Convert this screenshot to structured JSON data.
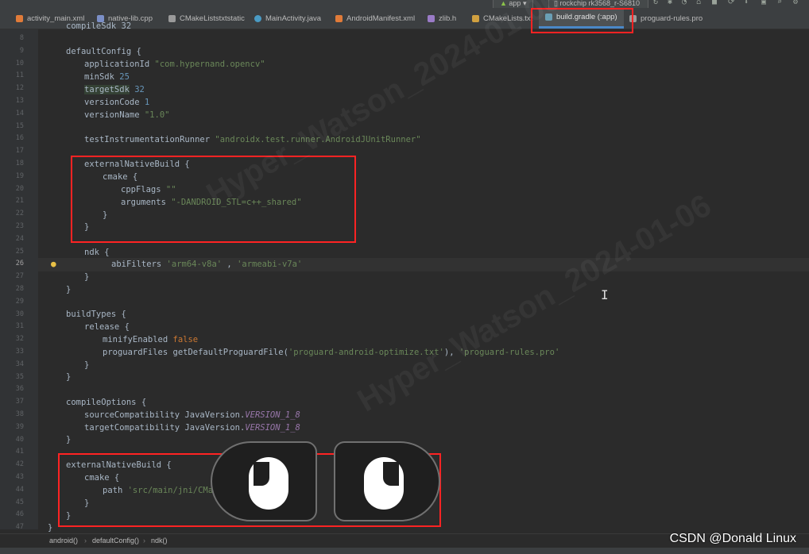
{
  "toolbar": {
    "run_config": "app",
    "device": "rockchip rk3568_r-S6810"
  },
  "tabs": [
    {
      "label": "activity_main.xml",
      "icon": "xml-file-icon",
      "color": "#e07b39"
    },
    {
      "label": "native-lib.cpp",
      "icon": "cpp-file-icon",
      "color": "#7b8fc7"
    },
    {
      "label": "CMakeListstxtstatic",
      "icon": "text-file-icon",
      "color": "#9a9a9a"
    },
    {
      "label": "MainActivity.java",
      "icon": "java-class-icon",
      "color": "#4a9bc4"
    },
    {
      "label": "AndroidManifest.xml",
      "icon": "xml-file-icon",
      "color": "#e07b39"
    },
    {
      "label": "zlib.h",
      "icon": "header-file-icon",
      "color": "#9a7bc7"
    },
    {
      "label": "CMakeLists.txt",
      "icon": "cmake-file-icon",
      "color": "#d0a040"
    },
    {
      "label": "build.gradle (:app)",
      "icon": "gradle-file-icon",
      "color": "#6a9fb5",
      "active": true
    },
    {
      "label": "proguard-rules.pro",
      "icon": "text-file-icon",
      "color": "#9a9a9a"
    }
  ],
  "line_numbers": [
    "8",
    "9",
    "10",
    "11",
    "12",
    "13",
    "14",
    "15",
    "16",
    "17",
    "18",
    "19",
    "20",
    "21",
    "22",
    "23",
    "24",
    "25",
    "26",
    "27",
    "28",
    "29",
    "30",
    "31",
    "32",
    "33",
    "34",
    "35",
    "36",
    "37",
    "38",
    "39",
    "40",
    "41",
    "42",
    "43",
    "44",
    "45",
    "46",
    "47"
  ],
  "code": {
    "l1": "compileSdk 32",
    "l3": "defaultConfig {",
    "l4_kw": "applicationId ",
    "l4_str": "\"com.hypernand.opencv\"",
    "l5_kw": "minSdk ",
    "l5_num": "25",
    "l6_kw": "targetSdk",
    "l6_num": " 32",
    "l7_kw": "versionCode ",
    "l7_num": "1",
    "l8_kw": "versionName ",
    "l8_str": "\"1.0\"",
    "l10_kw": "testInstrumentationRunner ",
    "l10_str": "\"androidx.test.runner.AndroidJUnitRunner\"",
    "l12": "externalNativeBuild {",
    "l13": "cmake {",
    "l14_kw": "cppFlags ",
    "l14_str": "\"\"",
    "l15_kw": "arguments ",
    "l15_str": "\"-DANDROID_STL=c++_shared\"",
    "l16": "}",
    "l17": "}",
    "l19": "ndk {",
    "l20_kw": "abiFilters ",
    "l20_str1": "'arm64-v8a'",
    "l20_sep": " , ",
    "l20_str2": "'armeabi-v7a'",
    "l21": "}",
    "l22": "}",
    "l24": "buildTypes {",
    "l25": "release {",
    "l26_kw": "minifyEnabled ",
    "l26_bool": "false",
    "l27_a": "proguardFiles getDefaultProguardFile(",
    "l27_s1": "'proguard-android-optimize.txt'",
    "l27_b": "), ",
    "l27_s2": "'proguard-rules.pro'",
    "l28": "}",
    "l29": "}",
    "l31": "compileOptions {",
    "l32_a": "sourceCompatibility JavaVersion.",
    "l32_b": "VERSION_1_8",
    "l33_a": "targetCompatibility JavaVersion.",
    "l33_b": "VERSION_1_8",
    "l34": "}",
    "l36": "externalNativeBuild {",
    "l37": "cmake {",
    "l38_kw": "path ",
    "l38_str": "'src/main/jni/CMakeLists.txt'",
    "l39": "}",
    "l40": "}",
    "l41": "}"
  },
  "breadcrumb": [
    "android()",
    "defaultConfig()",
    "ndk()"
  ],
  "watermark": "Hyper_Watson_2024-01-06",
  "credit": "CSDN @Donald Linux"
}
